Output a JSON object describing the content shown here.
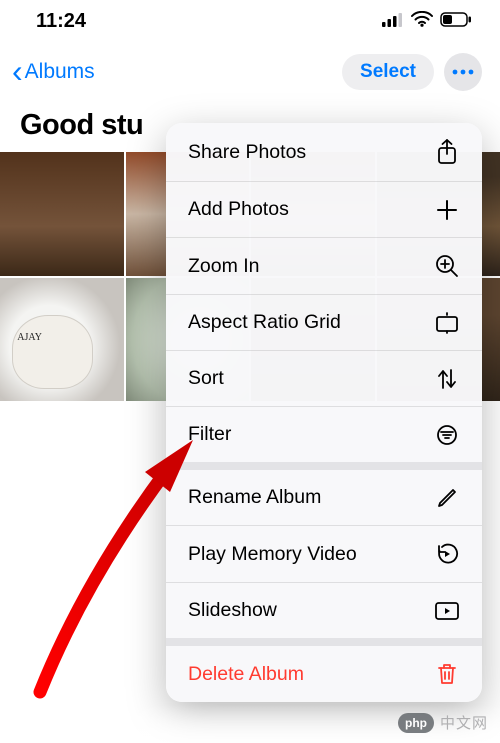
{
  "status": {
    "time": "11:24"
  },
  "nav": {
    "back_label": "Albums",
    "select_label": "Select"
  },
  "album": {
    "title": "Good stu",
    "cup_text": "AJAY"
  },
  "menu": {
    "items": [
      {
        "label": "Share Photos",
        "icon": "share-icon",
        "destructive": false,
        "section_end": false
      },
      {
        "label": "Add Photos",
        "icon": "plus-icon",
        "destructive": false,
        "section_end": false
      },
      {
        "label": "Zoom In",
        "icon": "zoom-in-icon",
        "destructive": false,
        "section_end": false
      },
      {
        "label": "Aspect Ratio Grid",
        "icon": "aspect-icon",
        "destructive": false,
        "section_end": false
      },
      {
        "label": "Sort",
        "icon": "sort-icon",
        "destructive": false,
        "section_end": false
      },
      {
        "label": "Filter",
        "icon": "filter-icon",
        "destructive": false,
        "section_end": true
      },
      {
        "label": "Rename Album",
        "icon": "pencil-icon",
        "destructive": false,
        "section_end": false
      },
      {
        "label": "Play Memory Video",
        "icon": "replay-icon",
        "destructive": false,
        "section_end": false
      },
      {
        "label": "Slideshow",
        "icon": "play-rect-icon",
        "destructive": false,
        "section_end": true
      },
      {
        "label": "Delete Album",
        "icon": "trash-icon",
        "destructive": true,
        "section_end": false
      }
    ]
  },
  "watermark": {
    "badge": "php",
    "text": "中文网"
  }
}
